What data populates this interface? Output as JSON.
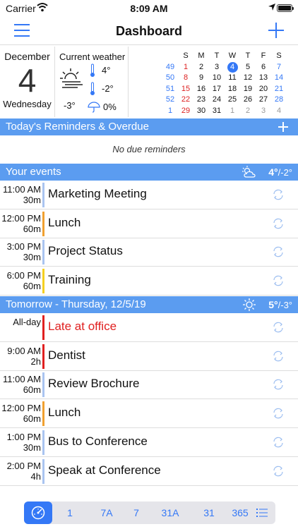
{
  "status": {
    "carrier": "Carrier",
    "time": "8:09 AM"
  },
  "nav": {
    "title": "Dashboard"
  },
  "today": {
    "month": "December",
    "day": "4",
    "weekday": "Wednesday"
  },
  "weather": {
    "title": "Current weather",
    "high": "4°",
    "low": "-2°",
    "temp": "-3°",
    "precip": "0%"
  },
  "mini_calendar": {
    "headers": [
      "S",
      "M",
      "T",
      "W",
      "T",
      "F",
      "S"
    ],
    "rows": [
      {
        "week": "49",
        "days": [
          "1",
          "2",
          "3",
          "4",
          "5",
          "6",
          "7"
        ]
      },
      {
        "week": "50",
        "days": [
          "8",
          "9",
          "10",
          "11",
          "12",
          "13",
          "14"
        ]
      },
      {
        "week": "51",
        "days": [
          "15",
          "16",
          "17",
          "18",
          "19",
          "20",
          "21"
        ]
      },
      {
        "week": "52",
        "days": [
          "22",
          "23",
          "24",
          "25",
          "26",
          "27",
          "28"
        ]
      },
      {
        "week": "1",
        "days": [
          "29",
          "30",
          "31",
          "1",
          "2",
          "3",
          "4"
        ]
      }
    ]
  },
  "reminders": {
    "title": "Today's Reminders & Overdue",
    "empty_text": "No due reminders"
  },
  "events_today": {
    "title": "Your events",
    "temp_high": "4°",
    "temp_low": "/-2°",
    "items": [
      {
        "time": "11:00 AM",
        "dur": "30m",
        "name": "Marketing Meeting",
        "color": "#a9c4f0"
      },
      {
        "time": "12:00 PM",
        "dur": "60m",
        "name": "Lunch",
        "color": "#f0a030"
      },
      {
        "time": "3:00 PM",
        "dur": "30m",
        "name": "Project Status",
        "color": "#a9c4f0"
      },
      {
        "time": "6:00 PM",
        "dur": "60m",
        "name": "Training",
        "color": "#f5d020"
      }
    ]
  },
  "events_tomorrow": {
    "title": "Tomorrow - Thursday, 12/5/19",
    "temp_high": "5°",
    "temp_low": "/-3°",
    "items": [
      {
        "time": "All-day",
        "dur": "",
        "name": "Late at office",
        "color": "#e02020",
        "name_color": "#e02020"
      },
      {
        "time": "9:00 AM",
        "dur": "2h",
        "name": "Dentist",
        "color": "#e02020"
      },
      {
        "time": "11:00 AM",
        "dur": "60m",
        "name": "Review Brochure",
        "color": "#a9c4f0"
      },
      {
        "time": "12:00 PM",
        "dur": "60m",
        "name": "Lunch",
        "color": "#f0a030"
      },
      {
        "time": "1:00 PM",
        "dur": "30m",
        "name": "Bus to Conference",
        "color": "#a9c4f0"
      },
      {
        "time": "2:00 PM",
        "dur": "4h",
        "name": "Speak at Conference",
        "color": "#a9c4f0"
      }
    ]
  },
  "tabs": [
    "1",
    "7A",
    "7",
    "31A",
    "31",
    "365"
  ]
}
